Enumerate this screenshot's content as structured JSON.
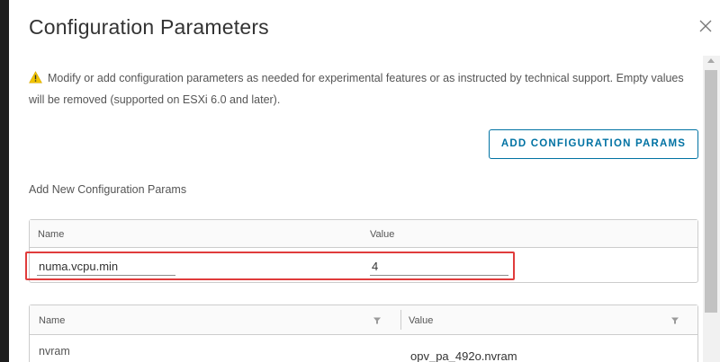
{
  "dialog": {
    "title": "Configuration Parameters",
    "close_icon": "close-icon"
  },
  "warning": {
    "icon": "warning-icon",
    "text": "Modify or add configuration parameters as needed for experimental features or as instructed by technical support. Empty values will be removed (supported on ESXi 6.0 and later)."
  },
  "add_button": {
    "label": "ADD CONFIGURATION PARAMS"
  },
  "new_params": {
    "section_label": "Add New Configuration Params",
    "columns": {
      "name": "Name",
      "value": "Value"
    },
    "row": {
      "name": "numa.vcpu.min",
      "value": "4"
    }
  },
  "existing_params": {
    "columns": {
      "name": "Name",
      "value": "Value"
    },
    "rows": [
      {
        "name": "nvram",
        "value": "opv_pa_492o.nvram"
      }
    ]
  },
  "colors": {
    "accent": "#0072a3",
    "highlight": "#e03c3c",
    "warning": "#f2c500"
  }
}
